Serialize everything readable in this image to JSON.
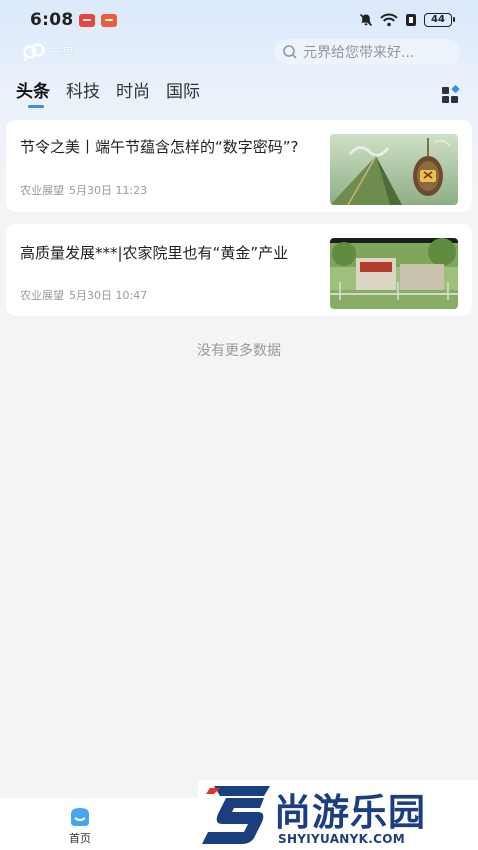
{
  "status_bar": {
    "time": "6:08",
    "battery": "44"
  },
  "header": {
    "logo_text": "元界",
    "search_placeholder": "元界给您带来好..."
  },
  "tabs": [
    {
      "label": "头条",
      "active": true
    },
    {
      "label": "科技",
      "active": false
    },
    {
      "label": "时尚",
      "active": false
    },
    {
      "label": "国际",
      "active": false
    }
  ],
  "articles": [
    {
      "title": "节令之美丨端午节蕴含怎样的“数字密码”?",
      "source": "农业展望",
      "date": "5月30日 11:23"
    },
    {
      "title": "高质量发展***|农家院里也有“黄金”产业",
      "source": "农业展望",
      "date": "5月30日 10:47"
    }
  ],
  "feed": {
    "no_more": "没有更多数据"
  },
  "bottom_nav": {
    "home_label": "首页"
  },
  "watermark": {
    "title": "尚游乐园",
    "url": "SHYIYUANYK.COM"
  },
  "colors": {
    "accent": "#3c8dee",
    "watermark": "#1b3e7e"
  }
}
